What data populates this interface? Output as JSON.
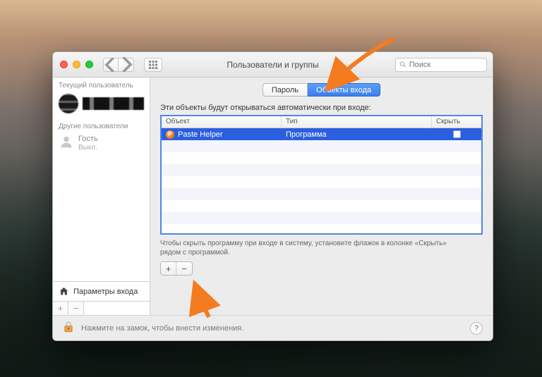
{
  "window": {
    "title": "Пользователи и группы"
  },
  "search": {
    "placeholder": "Поиск"
  },
  "sidebar": {
    "current_label": "Текущий пользователь",
    "others_label": "Другие пользователи",
    "guest": {
      "name": "Гость",
      "status": "Выкл."
    },
    "login_options": "Параметры входа"
  },
  "tabs": {
    "password": "Пароль",
    "login_items": "Объекты входа"
  },
  "main": {
    "autostart_label": "Эти объекты будут открываться автоматически при входе:",
    "columns": {
      "item": "Объект",
      "kind": "Тип",
      "hide": "Скрыть"
    },
    "rows": [
      {
        "name": "Paste Helper",
        "kind": "Программа",
        "hide": false
      }
    ],
    "hint": "Чтобы скрыть программу при входе в систему, установите флажок в колонке «Скрыть» рядом с программой."
  },
  "footer": {
    "lock_text": "Нажмите на замок, чтобы внести изменения."
  }
}
